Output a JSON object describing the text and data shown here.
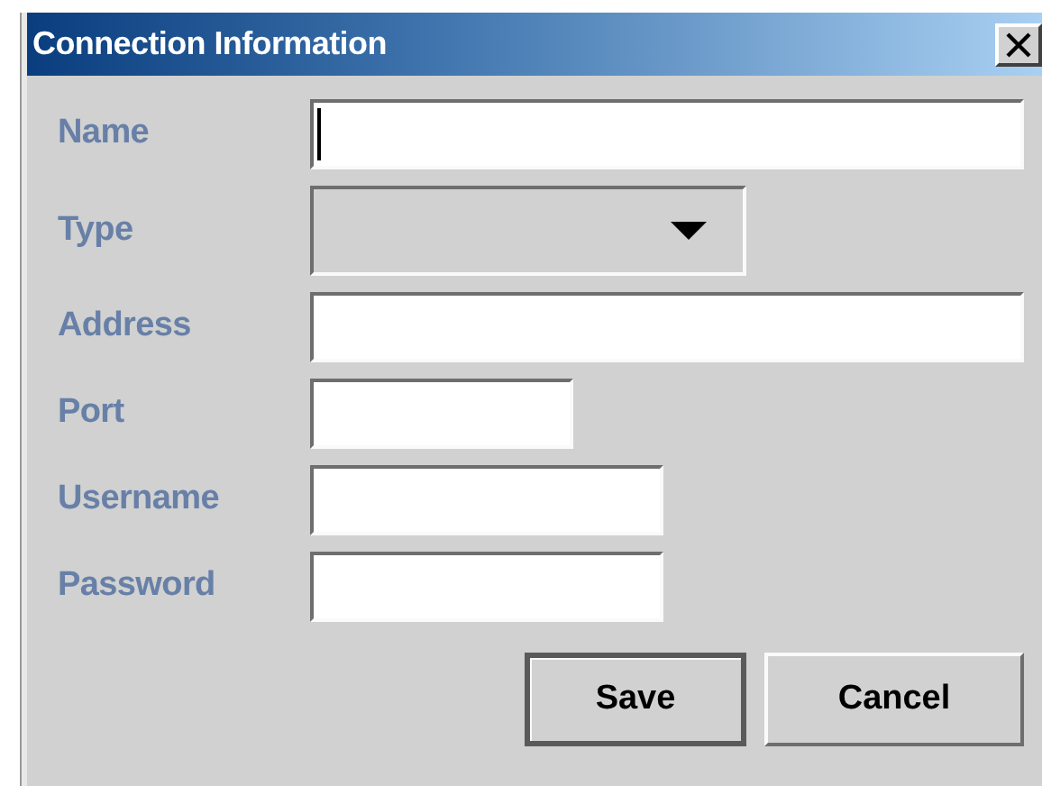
{
  "window": {
    "title": "Connection Information"
  },
  "fields": [
    {
      "label": "Name",
      "kind": "text",
      "focused": true
    },
    {
      "label": "Type",
      "kind": "combo",
      "focused": false
    },
    {
      "label": "Address",
      "kind": "text",
      "focused": false
    },
    {
      "label": "Port",
      "kind": "text",
      "focused": false
    },
    {
      "label": "Username",
      "kind": "text",
      "focused": false
    },
    {
      "label": "Password",
      "kind": "password",
      "focused": false
    }
  ],
  "buttons": [
    {
      "label": "Save",
      "default": true
    },
    {
      "label": "Cancel",
      "default": false
    }
  ]
}
